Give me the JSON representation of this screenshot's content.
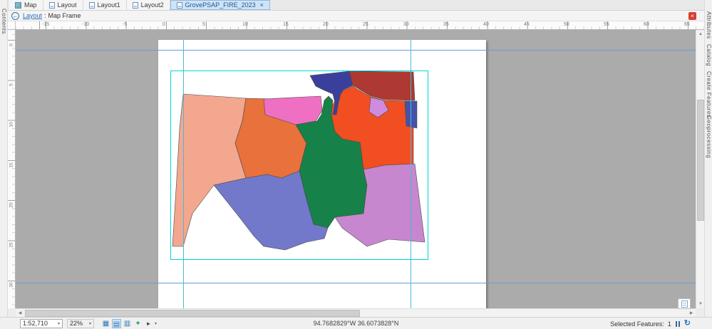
{
  "tab_bar": {
    "tabs": [
      {
        "label": "Map"
      },
      {
        "label": "Layout"
      },
      {
        "label": "Layout1"
      },
      {
        "label": "Layout2"
      },
      {
        "label": "GrovePSAP_FIRE_2023",
        "close_glyph": "×"
      }
    ]
  },
  "breadcrumb": {
    "back_glyph": "←",
    "link": "Layout",
    "separator": ":",
    "current": "Map Frame",
    "close_glyph": "×"
  },
  "side_panels": {
    "left": "Contents",
    "right": [
      "Attributes",
      "Catalog",
      "Create Features",
      "Geoprocessing"
    ]
  },
  "rulers": {
    "horizontal": [
      "-15",
      "-10",
      "-5",
      "0",
      "5",
      "10",
      "15",
      "20",
      "25",
      "30",
      "35",
      "40",
      "45",
      "50",
      "55",
      "60",
      "65"
    ],
    "vertical": [
      "0",
      "5",
      "10",
      "15",
      "20",
      "25",
      "30"
    ]
  },
  "status_bar": {
    "scale": "1:52,710",
    "zoom": "22%",
    "caret": "▾",
    "icons": [
      {
        "name": "grid-view-icon",
        "glyph": "▦"
      },
      {
        "name": "layout-view-icon",
        "glyph": "▤"
      },
      {
        "name": "pages-view-icon",
        "glyph": "▥"
      },
      {
        "name": "add-item-icon",
        "glyph": "+"
      },
      {
        "name": "select-tool-icon",
        "glyph": "►"
      }
    ],
    "coordinates": "94.7682829°W 36.6073828°N",
    "selected_label": "Selected Features:",
    "selected_count": "1",
    "refresh_glyph": "↻"
  },
  "scrollbar": {
    "up": "▲",
    "down": "▼",
    "left": "◀",
    "right": "▶"
  },
  "map": {
    "selection_color": "#00d5d5",
    "guide_blue": "#6b9bd2",
    "guide_cyan": "#4ab9d9",
    "districts": [
      {
        "name": "salmon",
        "color": "#f3a78e"
      },
      {
        "name": "orange",
        "color": "#e8713c"
      },
      {
        "name": "red-orange",
        "color": "#f14e21"
      },
      {
        "name": "dark-red",
        "color": "#ad3932"
      },
      {
        "name": "green",
        "color": "#168149"
      },
      {
        "name": "pink",
        "color": "#ef70c2"
      },
      {
        "name": "navy",
        "color": "#3b3f9c"
      },
      {
        "name": "light-orchid",
        "color": "#cf8bdd"
      },
      {
        "name": "indigo",
        "color": "#4452a7"
      },
      {
        "name": "slate-blue",
        "color": "#7278ca"
      },
      {
        "name": "orchid",
        "color": "#c787ce"
      }
    ]
  }
}
